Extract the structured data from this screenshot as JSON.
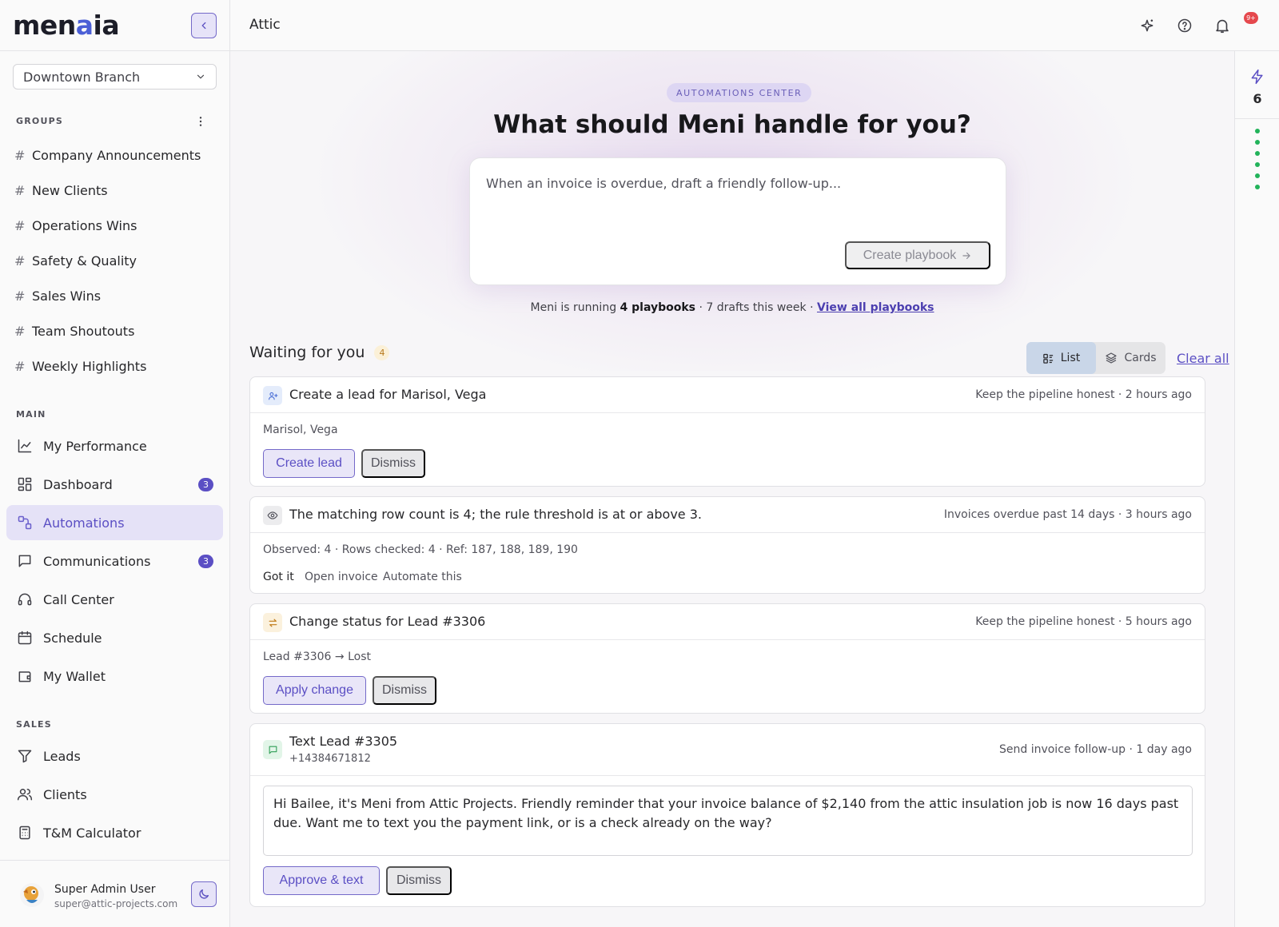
{
  "app": {
    "logo_prefix": "men",
    "logo_accent": "a",
    "logo_suffix": "ia",
    "page_title": "Attic",
    "notification_badge": "9+"
  },
  "sidebar": {
    "branch": "Downtown Branch",
    "groups_label": "GROUPS",
    "groups": [
      "Company Announcements",
      "New Clients",
      "Operations Wins",
      "Safety & Quality",
      "Sales Wins",
      "Team Shoutouts",
      "Weekly Highlights"
    ],
    "main_label": "MAIN",
    "main_items": [
      {
        "label": "My Performance",
        "icon": "chart-line-icon"
      },
      {
        "label": "Dashboard",
        "icon": "dashboard-icon",
        "badge": "3"
      },
      {
        "label": "Automations",
        "icon": "workflow-icon",
        "active": true
      },
      {
        "label": "Communications",
        "icon": "chat-icon",
        "badge": "3"
      },
      {
        "label": "Call Center",
        "icon": "headset-icon"
      },
      {
        "label": "Schedule",
        "icon": "calendar-icon"
      },
      {
        "label": "My Wallet",
        "icon": "wallet-icon"
      }
    ],
    "sales_label": "SALES",
    "sales_items": [
      {
        "label": "Leads",
        "icon": "filter-icon"
      },
      {
        "label": "Clients",
        "icon": "users-icon"
      },
      {
        "label": "T&M Calculator",
        "icon": "calculator-icon"
      }
    ],
    "user": {
      "name": "Super Admin User",
      "email": "super@attic-projects.com"
    }
  },
  "hero": {
    "pill": "AUTOMATIONS CENTER",
    "headline": "What should Meni handle for you?",
    "prompt_placeholder": "When an invoice is overdue, draft a friendly follow-up...",
    "create_button": "Create playbook",
    "running_prefix": "Meni is running ",
    "running_count": "4 playbooks",
    "running_suffix": " · 7 drafts this week · ",
    "view_all": "View all playbooks"
  },
  "waiting": {
    "title": "Waiting for you",
    "count": "4",
    "view_list": "List",
    "view_cards": "Cards",
    "active_view": "List",
    "clear_all": "Clear all"
  },
  "cards": [
    {
      "title": "Create a lead for Marisol, Vega",
      "meta": "Keep the pipeline honest · 2 hours ago",
      "detail": "Marisol, Vega",
      "primary": "Create lead",
      "dismiss": "Dismiss"
    },
    {
      "title": "The matching row count is 4; the rule threshold is at or above 3.",
      "meta": "Invoices overdue past 14 days · 3 hours ago",
      "detail": "Observed: 4 · Rows checked: 4 · Ref: 187, 188, 189, 190",
      "action_got_it": "Got it",
      "action_open": "Open invoice",
      "action_automate": "Automate this"
    },
    {
      "title": "Change status for Lead #3306",
      "meta": "Keep the pipeline honest · 5 hours ago",
      "detail": "Lead #3306 → Lost",
      "primary": "Apply change",
      "dismiss": "Dismiss"
    },
    {
      "title": "Text Lead #3305",
      "subtitle": "+14384671812",
      "meta": "Send invoice follow-up · 1 day ago",
      "message": "Hi Bailee, it's Meni from Attic Projects. Friendly reminder that your invoice balance of $2,140 from the attic insulation job is now 16 days past due. Want me to text you the payment link, or is a check already on the way?",
      "primary": "Approve & text",
      "dismiss": "Dismiss"
    }
  ],
  "rail": {
    "count": "6"
  },
  "colors": {
    "accent": "#5b4fc4",
    "active_bg": "#e5e2f7",
    "status_green": "#22b35a",
    "alert_red": "#e5484d"
  }
}
